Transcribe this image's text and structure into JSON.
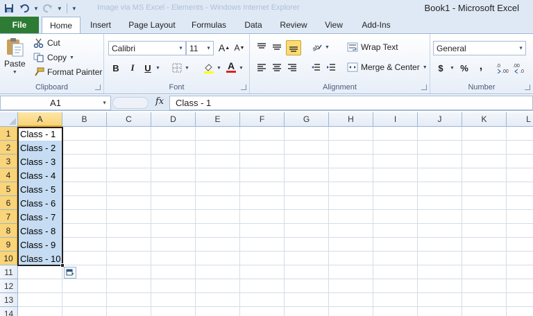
{
  "window": {
    "ghost_title": "Image via MS Excel - Elements - Windows Internet Explorer",
    "title": "Book1  -  Microsoft Excel"
  },
  "qat": {
    "icons": [
      "save-icon",
      "undo-icon",
      "redo-icon",
      "customize-qat-icon"
    ]
  },
  "tabs": {
    "file": "File",
    "items": [
      "Home",
      "Insert",
      "Page Layout",
      "Formulas",
      "Data",
      "Review",
      "View",
      "Add-Ins"
    ],
    "active": "Home"
  },
  "ribbon": {
    "clipboard": {
      "label": "Clipboard",
      "paste": "Paste",
      "cut": "Cut",
      "copy": "Copy",
      "format_painter": "Format Painter"
    },
    "font": {
      "label": "Font",
      "font_name": "Calibri",
      "font_size": "11",
      "bold": "B",
      "italic": "I",
      "underline": "U"
    },
    "alignment": {
      "label": "Alignment",
      "wrap_text": "Wrap Text",
      "merge_center": "Merge & Center"
    },
    "number": {
      "label": "Number",
      "format": "General",
      "currency": "$",
      "percent": "%",
      "comma": ","
    }
  },
  "formula_bar": {
    "name_box": "A1",
    "fx": "fx",
    "content": "Class - 1"
  },
  "grid": {
    "columns": [
      "A",
      "B",
      "C",
      "D",
      "E",
      "F",
      "G",
      "H",
      "I",
      "J",
      "K",
      "L"
    ],
    "rows": [
      "1",
      "2",
      "3",
      "4",
      "5",
      "6",
      "7",
      "8",
      "9",
      "10",
      "11",
      "12",
      "13",
      "14"
    ],
    "column_a_values": [
      "Class - 1",
      "Class - 2",
      "Class - 3",
      "Class - 4",
      "Class - 5",
      "Class - 6",
      "Class - 7",
      "Class - 8",
      "Class - 9",
      "Class - 10"
    ],
    "selection": "A1:A10",
    "accent": "#c5dcf2"
  }
}
